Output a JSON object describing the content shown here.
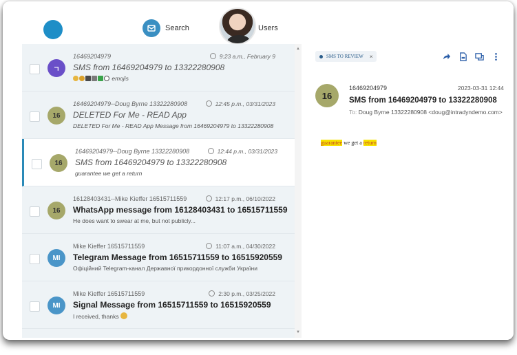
{
  "nav": {
    "search_label": "Search",
    "users_label": "Users"
  },
  "messages": [
    {
      "from": "16469204979",
      "time": "9:23 a.m., February 9",
      "subject": "SMS from 16469204979 to 13322280908",
      "snippet": "emojis",
      "avatar": "ㄱ",
      "avatar_color": "#6a4fc8",
      "selected": false
    },
    {
      "from": "16469204979--Doug Byrne 13322280908",
      "time": "12:45 p.m., 03/31/2023",
      "subject": "DELETED For Me - READ App",
      "snippet": "DELETED For Me - READ App Message from 16469204979 to 13322280908",
      "avatar": "16",
      "avatar_color": "#a6a86a",
      "selected": false
    },
    {
      "from": "16469204979--Doug Byrne 13322280908",
      "time": "12:44 p.m., 03/31/2023",
      "subject": "SMS from 16469204979 to 13322280908",
      "snippet": "guarantee we get a return",
      "avatar": "16",
      "avatar_color": "#a6a86a",
      "selected": true
    },
    {
      "from": "16128403431--Mike Kieffer 16515711559",
      "time": "12:17 p.m., 06/10/2022",
      "subject": "WhatsApp message from 16128403431 to 16515711559",
      "snippet": "He does want to swear at me, but not publicly...",
      "avatar": "16",
      "avatar_color": "#a6a86a",
      "selected": false
    },
    {
      "from": "Mike Kieffer 16515711559",
      "time": "11:07 a.m., 04/30/2022",
      "subject": "Telegram Message from 16515711559 to 16515920559",
      "snippet": "Офіційний Telegram-канал Державної прикордонної служби України",
      "avatar": "MI",
      "avatar_color": "#4a95c8",
      "selected": false
    },
    {
      "from": "Mike Kieffer 16515711559",
      "time": "2:30 p.m., 03/25/2022",
      "subject": "Signal Message from 16515711559 to 16515920559",
      "snippet": "I received, thanks",
      "avatar": "MI",
      "avatar_color": "#4a95c8",
      "selected": false
    }
  ],
  "detail": {
    "tag": "SMS TO REVIEW",
    "tag_close": "×",
    "avatar": "16",
    "from": "16469204979",
    "date": "2023-03-31 12:44",
    "subject": "SMS from 16469204979 to 13322280908",
    "to_label": "To:",
    "to": "Doug Byrne 13322280908 <doug@intradyndemo.com>",
    "body": {
      "word1": "guarantee",
      "middle": " we get a ",
      "word2": "return"
    }
  },
  "icons": [
    "search-icon",
    "forward-icon",
    "document-icon",
    "chat-icon",
    "more-icon",
    "clock-icon"
  ]
}
